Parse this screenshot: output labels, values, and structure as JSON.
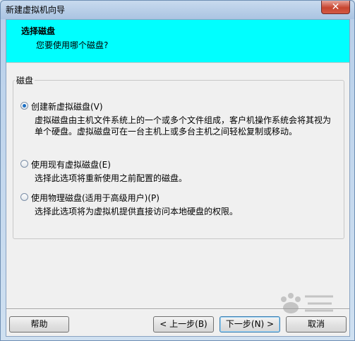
{
  "window": {
    "title": "新建虚拟机向导",
    "close_glyph": "✕"
  },
  "header": {
    "title": "选择磁盘",
    "subtitle": "您要使用哪个磁盘?"
  },
  "group": {
    "label": "磁盘",
    "options": [
      {
        "label": "创建新虚拟磁盘(V)",
        "description": "虚拟磁盘由主机文件系统上的一个或多个文件组成，客户机操作系统会将其视为单个硬盘。虚拟磁盘可在一台主机上或多台主机之间轻松复制或移动。",
        "selected": true
      },
      {
        "label": "使用现有虚拟磁盘(E)",
        "description": "选择此选项将重新使用之前配置的磁盘。",
        "selected": false
      },
      {
        "label": "使用物理磁盘(适用于高级用户)(P)",
        "description": "选择此选项将为虚拟机提供直接访问本地硬盘的权限。",
        "selected": false
      }
    ]
  },
  "buttons": {
    "help": "帮助",
    "back": "< 上一步(B)",
    "next": "下一步(N) >",
    "cancel": "取消"
  },
  "colors": {
    "header_bg": "#00ffff",
    "dialog_bg": "#f0f0f0",
    "frame": "#b9d0ea",
    "close_button": "#c7442f"
  }
}
